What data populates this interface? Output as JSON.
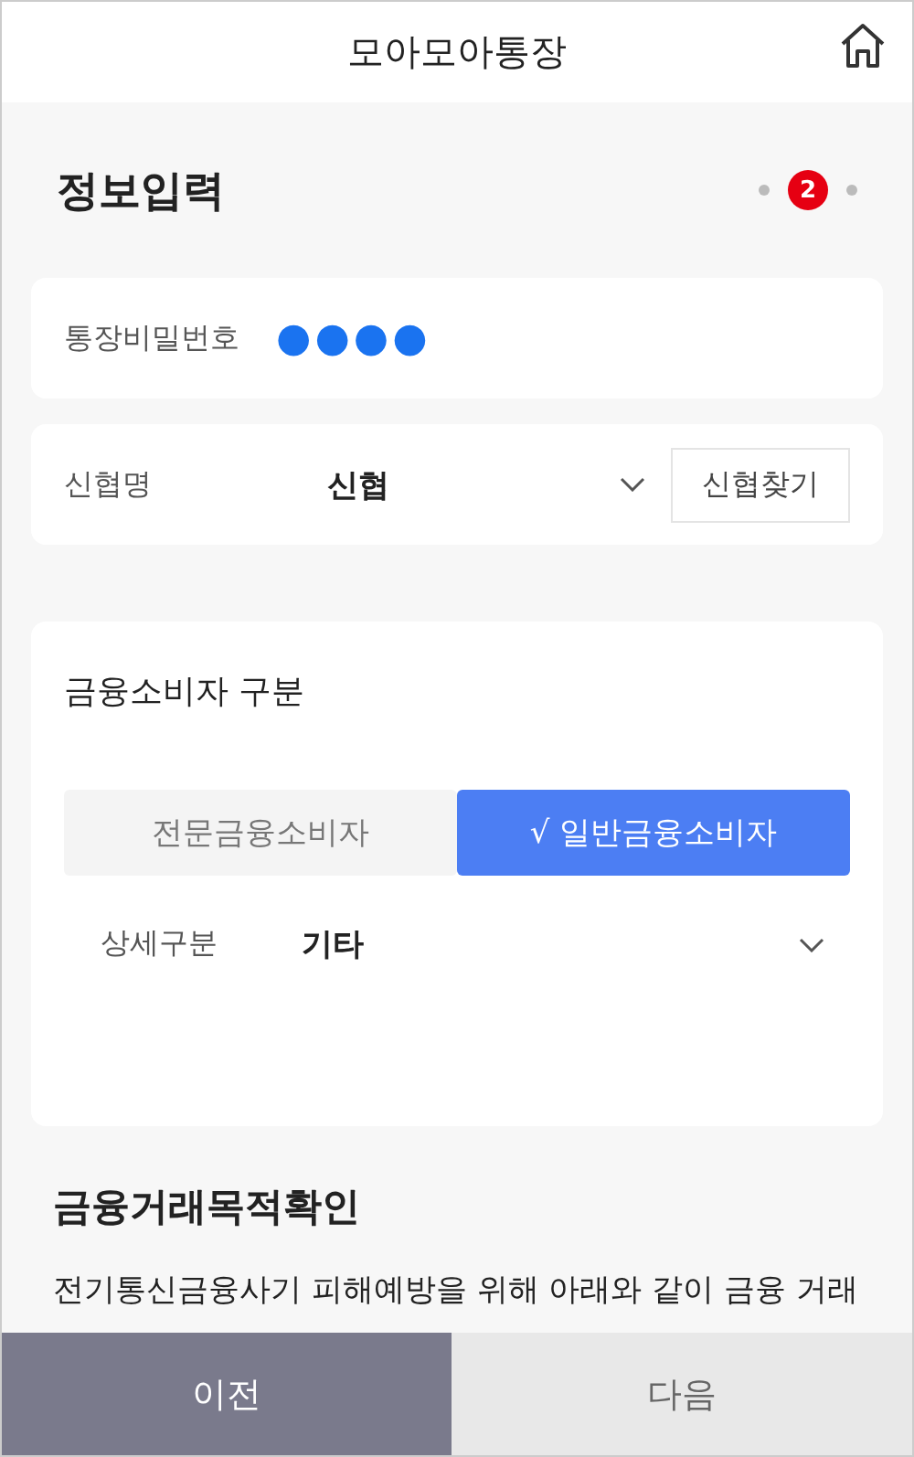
{
  "header": {
    "title": "모아모아통장"
  },
  "page_title": "정보입력",
  "steps": [
    {
      "selected": false
    },
    {
      "label": "2",
      "selected": true
    },
    {
      "selected": false
    }
  ],
  "password": {
    "label": "통장비밀번호",
    "value": "●●●●"
  },
  "union": {
    "label": "신협명",
    "value": "신협",
    "button": "신협찾기"
  },
  "consumer": {
    "title": "금융소비자 구분",
    "options": [
      {
        "label": "전문금융소비자",
        "selected": false
      },
      {
        "label": "√ 일반금융소비자",
        "selected": true
      }
    ],
    "detail_label": "상세구분",
    "detail_value": "기타"
  },
  "purpose": {
    "title": "금융거래목적확인",
    "text": "전기통신금융사기 피해예방을 위해 아래와 같이 금융 거래"
  },
  "footer": [
    {
      "label": "이전",
      "kind": "secondary"
    },
    {
      "label": "다음",
      "kind": "primary"
    }
  ]
}
